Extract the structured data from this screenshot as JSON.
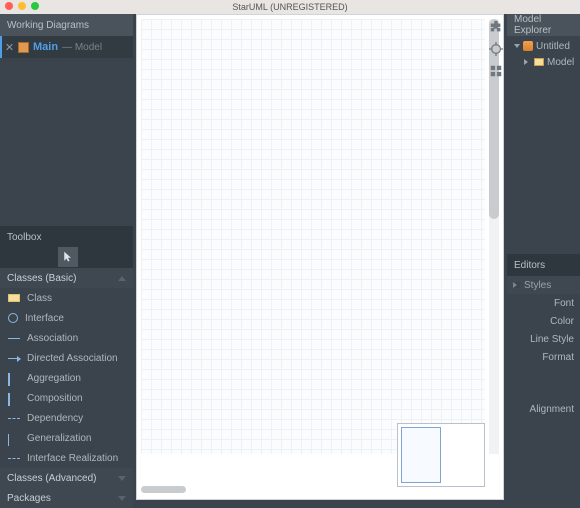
{
  "app": {
    "title": "StarUML (UNREGISTERED)"
  },
  "working": {
    "header": "Working Diagrams",
    "item": {
      "name": "Main",
      "context": "— Model"
    }
  },
  "toolbox": {
    "header": "Toolbox",
    "sections": {
      "basic": {
        "label": "Classes (Basic)",
        "items": [
          "Class",
          "Interface",
          "Association",
          "Directed Association",
          "Aggregation",
          "Composition",
          "Dependency",
          "Generalization",
          "Interface Realization"
        ]
      },
      "advanced": {
        "label": "Classes (Advanced)"
      },
      "packages": {
        "label": "Packages"
      }
    }
  },
  "explorer": {
    "header": "Model Explorer",
    "root": "Untitled",
    "child": "Model"
  },
  "editors": {
    "header": "Editors",
    "styles_label": "Styles",
    "items": [
      "Font",
      "Color",
      "Line Style",
      "Format"
    ],
    "alignment": "Alignment"
  }
}
